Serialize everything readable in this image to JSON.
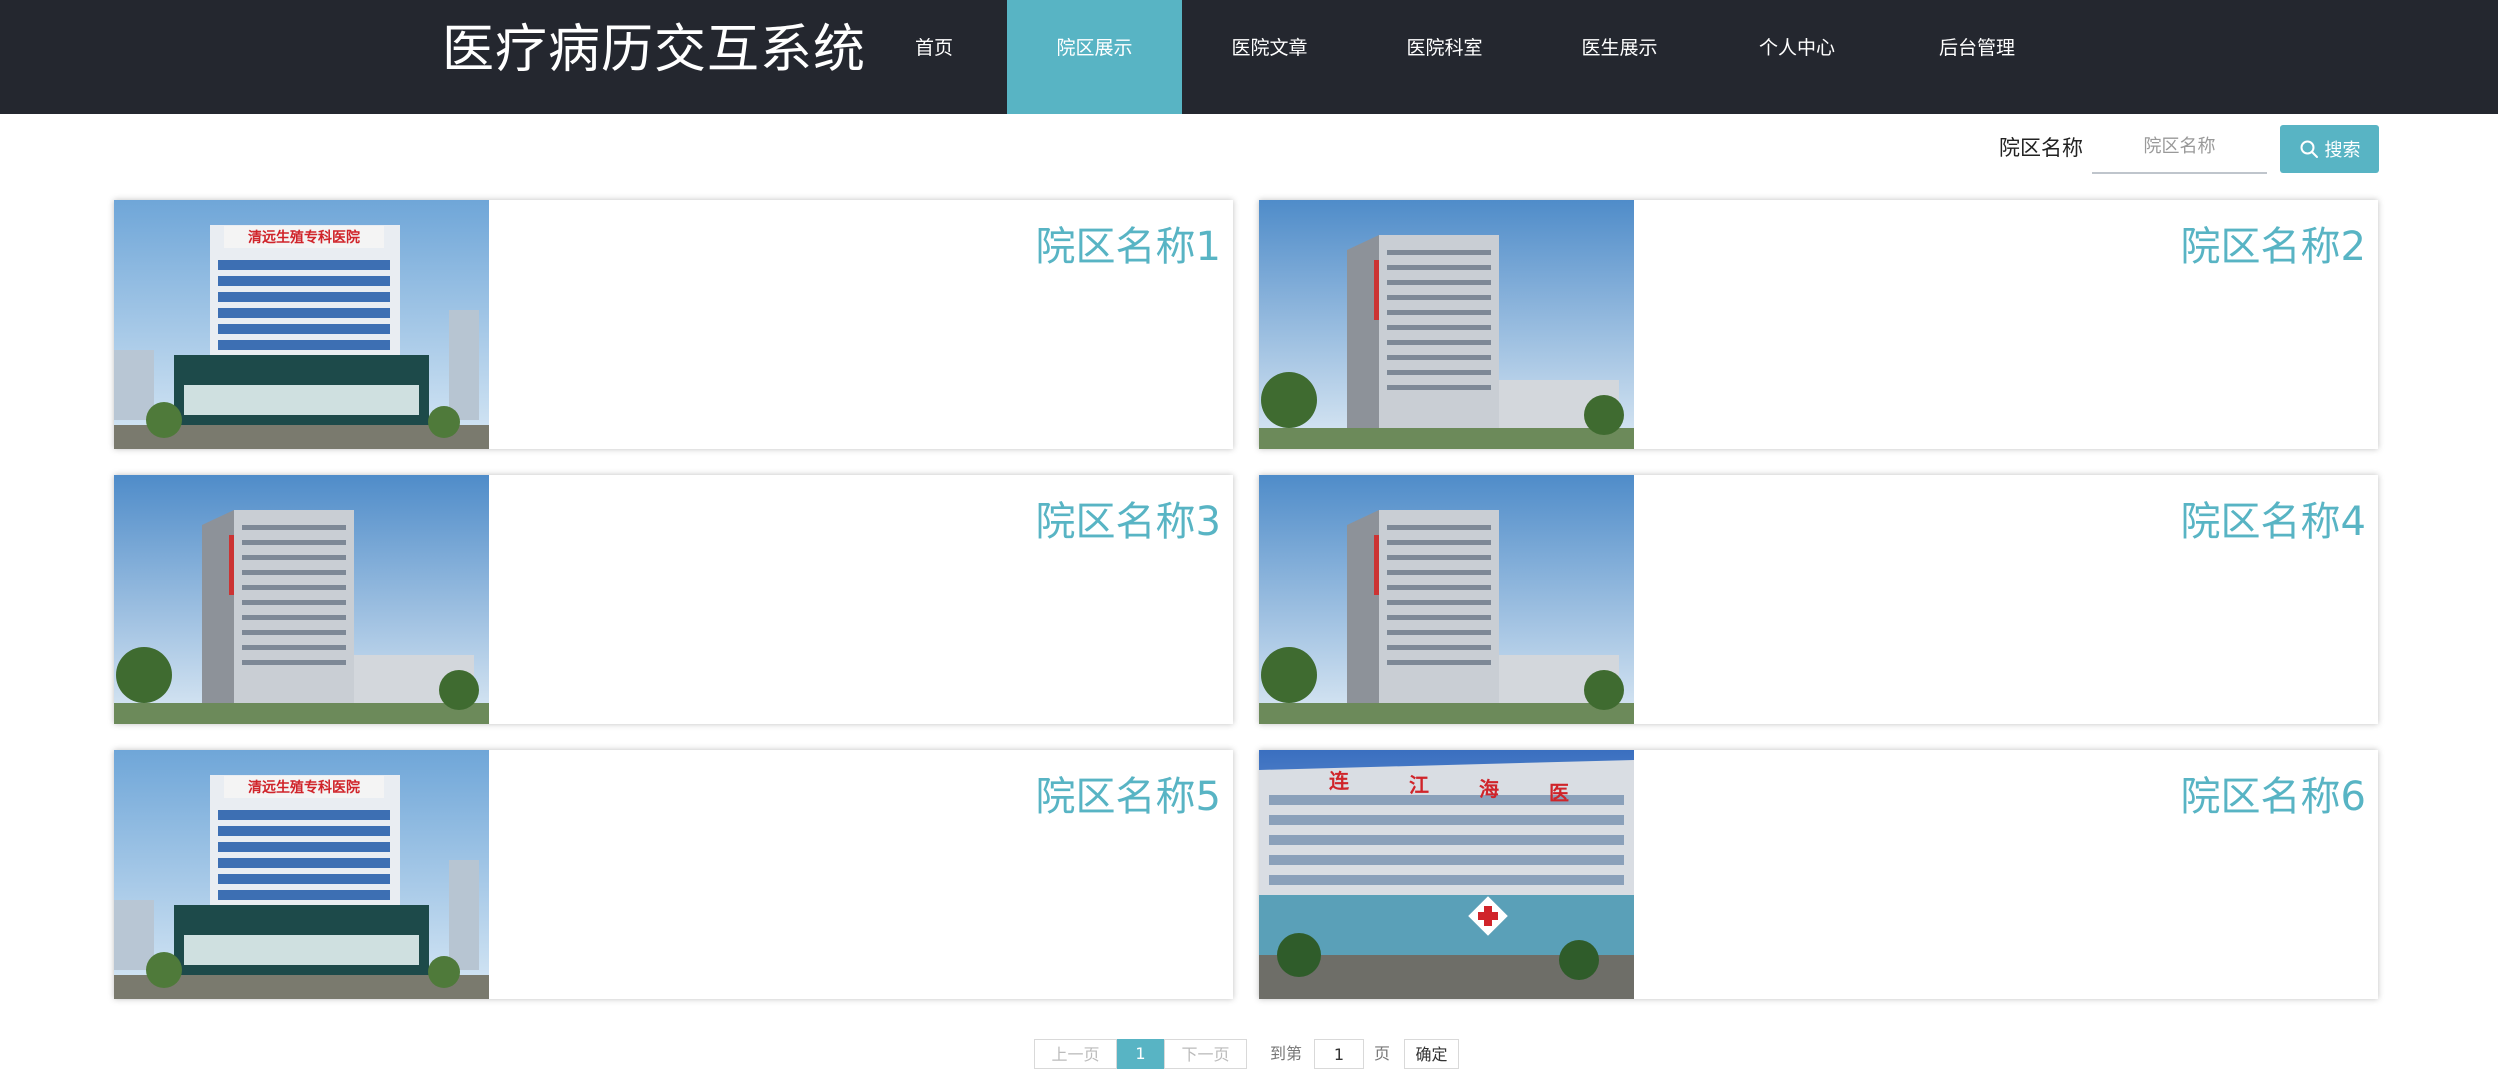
{
  "header": {
    "title": "医疗病历交互系统",
    "nav": [
      "首页",
      "院区展示",
      "医院文章",
      "医院科室",
      "医生展示",
      "个人中心",
      "后台管理"
    ],
    "active": "院区展示"
  },
  "search": {
    "label": "院区名称",
    "placeholder": "院区名称",
    "button": "搜索",
    "icon": "search-icon"
  },
  "cards": [
    {
      "name": "院区名称1",
      "image": "hospital-building-photo"
    },
    {
      "name": "院区名称2",
      "image": "hospital-tower-photo"
    },
    {
      "name": "院区名称3",
      "image": "hospital-tower-photo"
    },
    {
      "name": "院区名称4",
      "image": "hospital-tower-photo"
    },
    {
      "name": "院区名称5",
      "image": "hospital-building-photo"
    },
    {
      "name": "院区名称6",
      "image": "hospital-wide-building-photo"
    }
  ],
  "pagination": {
    "prev": "上一页",
    "current": "1",
    "next": "下一页",
    "goto": "到第",
    "page_value": "1",
    "page_unit": "页",
    "confirm": "确定"
  },
  "colors": {
    "accent": "#58b4c4",
    "header_bg": "#24272f"
  }
}
